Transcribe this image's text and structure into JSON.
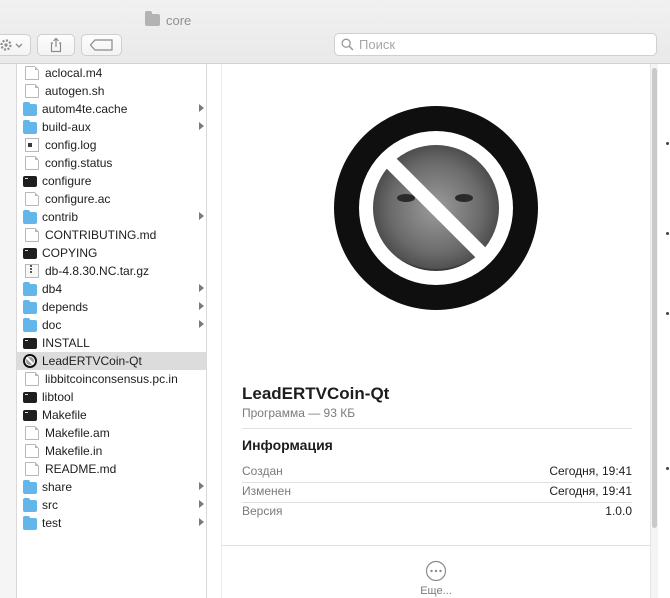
{
  "window": {
    "title": "core"
  },
  "toolbar": {
    "search_placeholder": "Поиск"
  },
  "files": [
    {
      "name": "aclocal.m4",
      "icon": "doc",
      "folder": false,
      "selected": false
    },
    {
      "name": "autogen.sh",
      "icon": "doc",
      "folder": false,
      "selected": false
    },
    {
      "name": "autom4te.cache",
      "icon": "folder",
      "folder": true,
      "selected": false
    },
    {
      "name": "build-aux",
      "icon": "folder",
      "folder": true,
      "selected": false
    },
    {
      "name": "config.log",
      "icon": "log",
      "folder": false,
      "selected": false
    },
    {
      "name": "config.status",
      "icon": "doc",
      "folder": false,
      "selected": false
    },
    {
      "name": "configure",
      "icon": "term",
      "folder": false,
      "selected": false
    },
    {
      "name": "configure.ac",
      "icon": "doc",
      "folder": false,
      "selected": false
    },
    {
      "name": "contrib",
      "icon": "folder",
      "folder": true,
      "selected": false
    },
    {
      "name": "CONTRIBUTING.md",
      "icon": "doc",
      "folder": false,
      "selected": false
    },
    {
      "name": "COPYING",
      "icon": "term",
      "folder": false,
      "selected": false
    },
    {
      "name": "db-4.8.30.NC.tar.gz",
      "icon": "archive",
      "folder": false,
      "selected": false
    },
    {
      "name": "db4",
      "icon": "folder",
      "folder": true,
      "selected": false
    },
    {
      "name": "depends",
      "icon": "folder",
      "folder": true,
      "selected": false
    },
    {
      "name": "doc",
      "icon": "folder",
      "folder": true,
      "selected": false
    },
    {
      "name": "INSTALL",
      "icon": "term",
      "folder": false,
      "selected": false
    },
    {
      "name": "LeadERTVCoin-Qt",
      "icon": "app",
      "folder": false,
      "selected": true
    },
    {
      "name": "libbitcoinconsensus.pc.in",
      "icon": "doc",
      "folder": false,
      "selected": false
    },
    {
      "name": "libtool",
      "icon": "term",
      "folder": false,
      "selected": false
    },
    {
      "name": "Makefile",
      "icon": "term",
      "folder": false,
      "selected": false
    },
    {
      "name": "Makefile.am",
      "icon": "doc",
      "folder": false,
      "selected": false
    },
    {
      "name": "Makefile.in",
      "icon": "doc",
      "folder": false,
      "selected": false
    },
    {
      "name": "README.md",
      "icon": "doc",
      "folder": false,
      "selected": false
    },
    {
      "name": "share",
      "icon": "folder",
      "folder": true,
      "selected": false
    },
    {
      "name": "src",
      "icon": "folder",
      "folder": true,
      "selected": false
    },
    {
      "name": "test",
      "icon": "folder",
      "folder": true,
      "selected": false
    }
  ],
  "preview": {
    "title": "LeadERTVCoin-Qt",
    "subtitle": "Программа — 93 КБ",
    "info_header": "Информация",
    "rows": [
      {
        "key": "Создан",
        "value": "Сегодня, 19:41"
      },
      {
        "key": "Изменен",
        "value": "Сегодня, 19:41"
      },
      {
        "key": "Версия",
        "value": "1.0.0"
      }
    ],
    "more_label": "Еще..."
  }
}
